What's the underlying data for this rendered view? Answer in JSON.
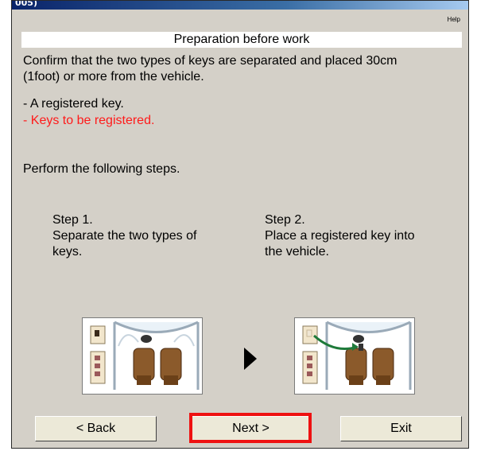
{
  "window": {
    "title_partial": "005)"
  },
  "menu": {
    "help_label": "Help"
  },
  "header": {
    "title": "Preparation before work"
  },
  "instructions": {
    "line1": "Confirm that the two types of keys are separated and placed 30cm",
    "line2": "(1foot) or more from the vehicle.",
    "key_registered": "- A registered key.",
    "key_to_register": "- Keys to be registered.",
    "perform": "Perform the following steps."
  },
  "steps": [
    {
      "title": "Step 1.",
      "line1": "Separate the two types of",
      "line2": "keys."
    },
    {
      "title": "Step 2.",
      "line1": "Place a registered key into",
      "line2": "the vehicle."
    }
  ],
  "buttons": {
    "back": "< Back",
    "next": "Next >",
    "exit": "Exit"
  },
  "colors": {
    "highlight": "#ee1111",
    "warning_text": "#ff1a1a"
  }
}
